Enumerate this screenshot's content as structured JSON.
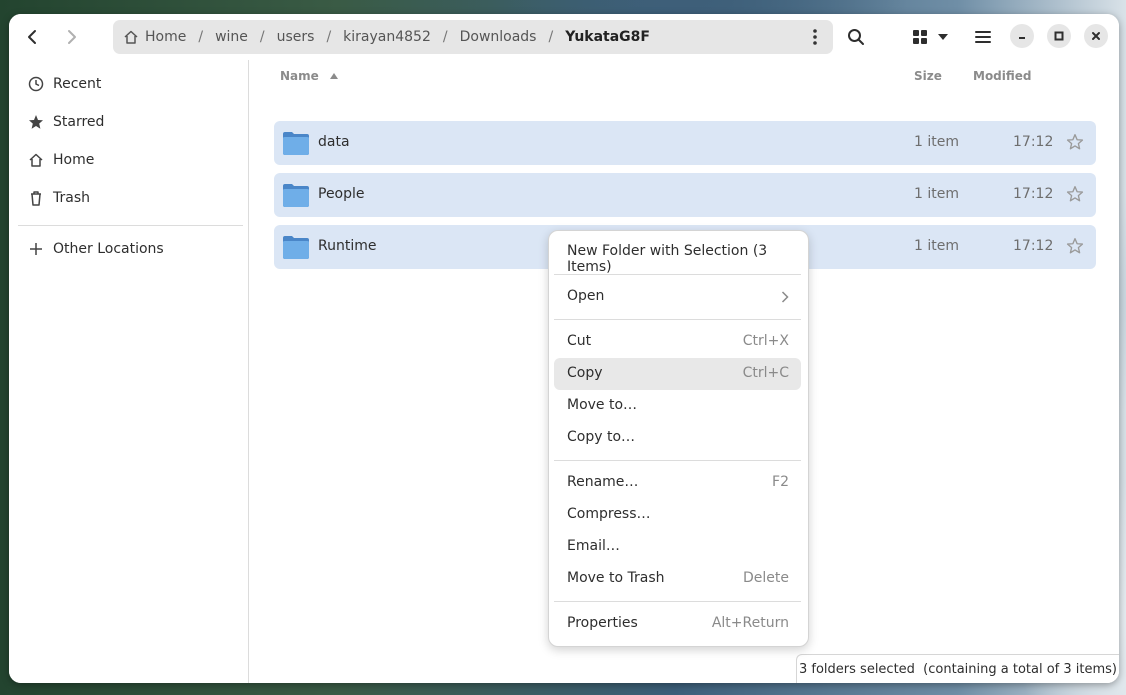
{
  "window": {
    "pathbar": [
      "Home",
      "wine",
      "users",
      "kirayan4852",
      "Downloads",
      "YukataG8F"
    ],
    "path_separator": "/"
  },
  "sidebar": {
    "items": [
      {
        "label": "Recent",
        "icon": "clock-icon"
      },
      {
        "label": "Starred",
        "icon": "star-icon"
      },
      {
        "label": "Home",
        "icon": "home-icon"
      },
      {
        "label": "Trash",
        "icon": "trash-icon"
      },
      {
        "label": "Other Locations",
        "icon": "plus-icon"
      }
    ]
  },
  "columns": {
    "name": "Name",
    "size": "Size",
    "modified": "Modified"
  },
  "files": [
    {
      "name": "data",
      "size": "1 item",
      "modified": "17:12"
    },
    {
      "name": "People",
      "size": "1 item",
      "modified": "17:12"
    },
    {
      "name": "Runtime",
      "size": "1 item",
      "modified": "17:12"
    }
  ],
  "context_menu": {
    "new_folder": "New Folder with Selection (3 Items)",
    "open": "Open",
    "cut": "Cut",
    "cut_key": "Ctrl+X",
    "copy": "Copy",
    "copy_key": "Ctrl+C",
    "move_to": "Move to…",
    "copy_to": "Copy to…",
    "rename": "Rename…",
    "rename_key": "F2",
    "compress": "Compress…",
    "email": "Email…",
    "trash": "Move to Trash",
    "trash_key": "Delete",
    "properties": "Properties",
    "properties_key": "Alt+Return"
  },
  "status": "3 folders selected  (containing a total of 3 items)",
  "colors": {
    "selection": "#dbe6f5",
    "folder": "#5b9bd5",
    "accent": "#3584e4"
  }
}
